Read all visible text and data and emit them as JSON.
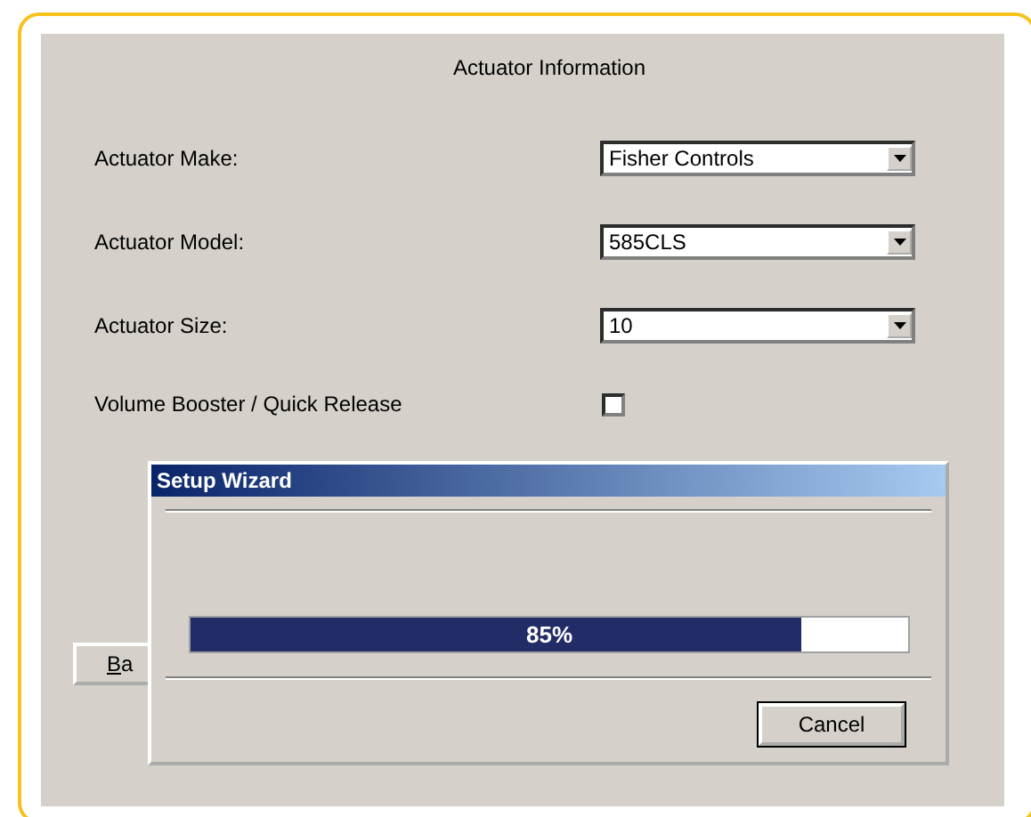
{
  "panel": {
    "title": "Actuator Information",
    "fields": [
      {
        "kind": "combo",
        "label": "Actuator Make:",
        "value": "Fisher Controls"
      },
      {
        "kind": "combo",
        "label": "Actuator Model:",
        "value": "585CLS"
      },
      {
        "kind": "combo",
        "label": "Actuator Size:",
        "value": "10"
      },
      {
        "kind": "checkbox",
        "label": "Volume Booster / Quick Release",
        "checked": false
      }
    ],
    "back_button": "Ba"
  },
  "dialog": {
    "title": "Setup Wizard",
    "progress": {
      "level": 0.85,
      "reading": "85%"
    },
    "button": "Cancel"
  }
}
